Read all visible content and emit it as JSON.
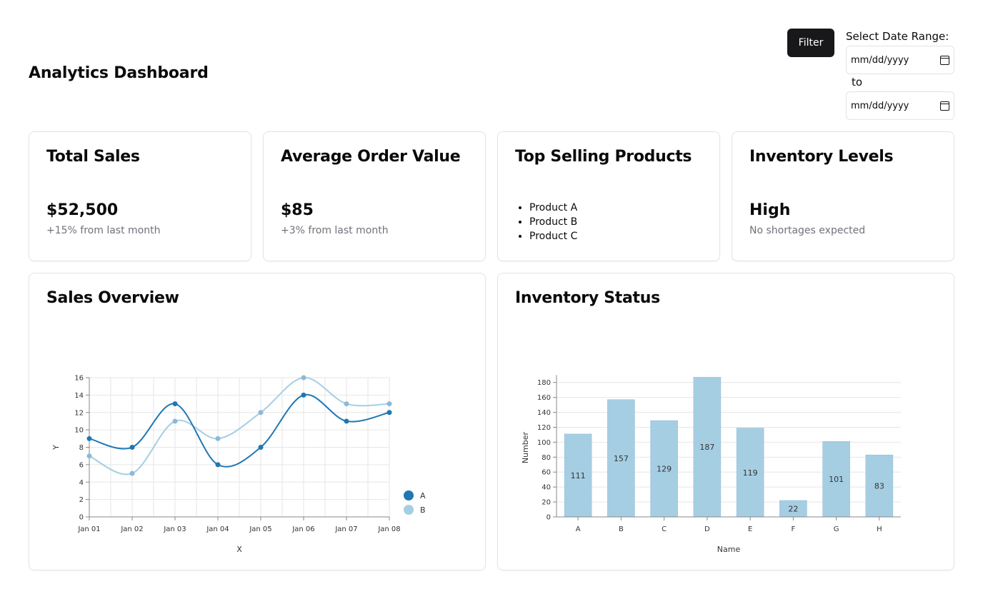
{
  "header": {
    "title": "Analytics Dashboard",
    "filter_label": "Filter",
    "date_range_label": "Select Date Range:",
    "date_from_placeholder": "mm/dd/yyyy",
    "date_to_placeholder": "mm/dd/yyyy",
    "date_separator": "to"
  },
  "stats": [
    {
      "title": "Total Sales",
      "value": "$52,500",
      "sub": "+15% from last month"
    },
    {
      "title": "Average Order Value",
      "value": "$85",
      "sub": "+3% from last month"
    },
    {
      "title": "Top Selling Products",
      "items": [
        "Product A",
        "Product B",
        "Product C"
      ]
    },
    {
      "title": "Inventory Levels",
      "value": "High",
      "sub": "No shortages expected"
    }
  ],
  "panels": {
    "sales_title": "Sales Overview",
    "inventory_title": "Inventory Status"
  },
  "colors": {
    "series_a": "#1f77b4",
    "series_b": "#a6cee3",
    "bar": "#a6cee3"
  },
  "chart_data": [
    {
      "type": "line",
      "title": "",
      "xlabel": "X",
      "ylabel": "Y",
      "categories": [
        "Jan 01",
        "Jan 02",
        "Jan 03",
        "Jan 04",
        "Jan 05",
        "Jan 06",
        "Jan 07",
        "Jan 08"
      ],
      "ylim": [
        0,
        16
      ],
      "yticks": [
        0,
        2,
        4,
        6,
        8,
        10,
        12,
        14,
        16
      ],
      "grid": true,
      "legend": "right",
      "series": [
        {
          "name": "A",
          "values": [
            9,
            8,
            13,
            6,
            8,
            14,
            11,
            12
          ]
        },
        {
          "name": "B",
          "values": [
            7,
            5,
            11,
            9,
            12,
            16,
            13,
            13
          ]
        }
      ]
    },
    {
      "type": "bar",
      "title": "",
      "xlabel": "Name",
      "ylabel": "Number",
      "categories": [
        "A",
        "B",
        "C",
        "D",
        "E",
        "F",
        "G",
        "H"
      ],
      "values": [
        111,
        157,
        129,
        187,
        119,
        22,
        101,
        83
      ],
      "ylim": [
        0,
        190
      ],
      "yticks": [
        0,
        20,
        40,
        60,
        80,
        100,
        120,
        140,
        160,
        180
      ],
      "grid": true
    }
  ]
}
